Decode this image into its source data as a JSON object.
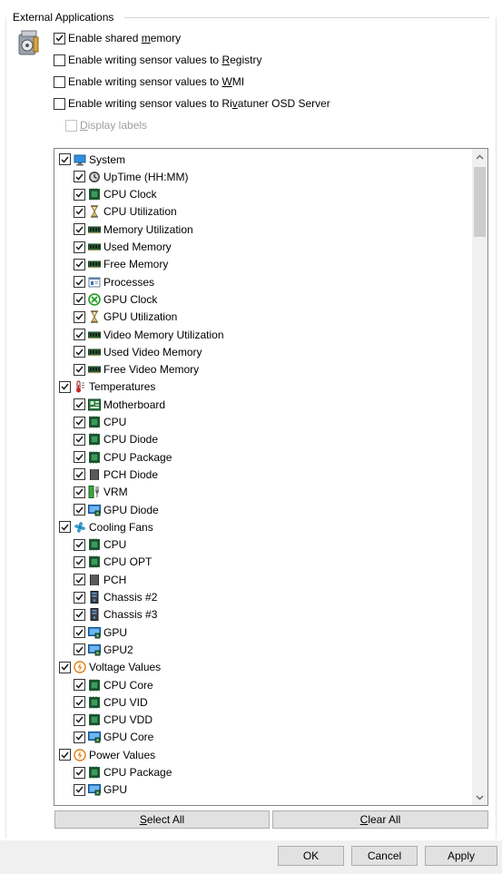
{
  "group": {
    "title": "External Applications"
  },
  "options": [
    {
      "pre": "Enable shared ",
      "key": "m",
      "post": "emory",
      "checked": true,
      "enabled": true
    },
    {
      "pre": "Enable writing sensor values to ",
      "key": "R",
      "post": "egistry",
      "checked": false,
      "enabled": true
    },
    {
      "pre": "Enable writing sensor values to ",
      "key": "W",
      "post": "MI",
      "checked": false,
      "enabled": true
    },
    {
      "pre": "Enable writing sensor values to Ri",
      "key": "v",
      "post": "atuner OSD Server",
      "checked": false,
      "enabled": true
    },
    {
      "pre": "",
      "key": "D",
      "post": "isplay labels",
      "checked": false,
      "enabled": false
    }
  ],
  "tree": [
    {
      "label": "System",
      "icon": "monitor-icon",
      "children": [
        {
          "label": "UpTime (HH:MM)",
          "icon": "clock-icon"
        },
        {
          "label": "CPU Clock",
          "icon": "chip-icon"
        },
        {
          "label": "CPU Utilization",
          "icon": "hourglass-icon"
        },
        {
          "label": "Memory Utilization",
          "icon": "memory-icon"
        },
        {
          "label": "Used Memory",
          "icon": "memory-icon"
        },
        {
          "label": "Free Memory",
          "icon": "memory-icon"
        },
        {
          "label": "Processes",
          "icon": "window-icon"
        },
        {
          "label": "GPU Clock",
          "icon": "xbox-icon"
        },
        {
          "label": "GPU Utilization",
          "icon": "hourglass-icon"
        },
        {
          "label": "Video Memory Utilization",
          "icon": "memory-icon"
        },
        {
          "label": "Used Video Memory",
          "icon": "memory-icon"
        },
        {
          "label": "Free Video Memory",
          "icon": "memory-icon"
        }
      ]
    },
    {
      "label": "Temperatures",
      "icon": "thermometer-icon",
      "children": [
        {
          "label": "Motherboard",
          "icon": "motherboard-icon"
        },
        {
          "label": "CPU",
          "icon": "chip-icon"
        },
        {
          "label": "CPU Diode",
          "icon": "chip-icon"
        },
        {
          "label": "CPU Package",
          "icon": "chip-icon"
        },
        {
          "label": "PCH Diode",
          "icon": "pch-icon"
        },
        {
          "label": "VRM",
          "icon": "vrm-icon"
        },
        {
          "label": "GPU Diode",
          "icon": "gpu-icon"
        }
      ]
    },
    {
      "label": "Cooling Fans",
      "icon": "fan-icon",
      "children": [
        {
          "label": "CPU",
          "icon": "chip-icon"
        },
        {
          "label": "CPU OPT",
          "icon": "chip-icon"
        },
        {
          "label": "PCH",
          "icon": "pch-icon"
        },
        {
          "label": "Chassis #2",
          "icon": "chassis-icon"
        },
        {
          "label": "Chassis #3",
          "icon": "chassis-icon"
        },
        {
          "label": "GPU",
          "icon": "gpu-icon"
        },
        {
          "label": "GPU2",
          "icon": "gpu-icon"
        }
      ]
    },
    {
      "label": "Voltage Values",
      "icon": "voltage-icon",
      "children": [
        {
          "label": "CPU Core",
          "icon": "chip-icon"
        },
        {
          "label": "CPU VID",
          "icon": "chip-icon"
        },
        {
          "label": "CPU VDD",
          "icon": "chip-icon"
        },
        {
          "label": "GPU Core",
          "icon": "gpu-icon"
        }
      ]
    },
    {
      "label": "Power Values",
      "icon": "power-icon",
      "children": [
        {
          "label": "CPU Package",
          "icon": "chip-icon"
        },
        {
          "label": "GPU",
          "icon": "gpu-icon"
        }
      ]
    }
  ],
  "list_buttons": {
    "select_all": {
      "key": "S",
      "rest": "elect All"
    },
    "clear_all": {
      "key": "C",
      "rest": "lear All"
    }
  },
  "dialog_buttons": {
    "ok": "OK",
    "cancel": "Cancel",
    "apply": "Apply"
  }
}
